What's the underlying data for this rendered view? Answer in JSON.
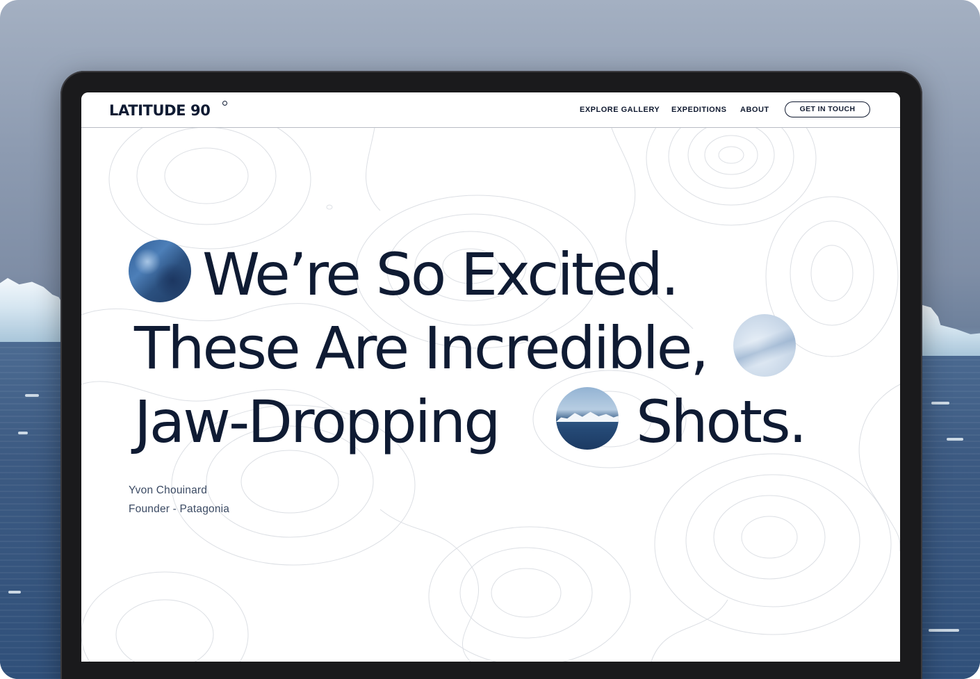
{
  "nav": {
    "logo": "LATITUDE 90",
    "links": [
      {
        "label": "EXPLORE GALLERY"
      },
      {
        "label": "EXPEDITIONS"
      },
      {
        "label": "ABOUT"
      }
    ],
    "cta": "GET IN TOUCH"
  },
  "hero": {
    "line1": "We’re So Excited.",
    "line2": "These Are Incredible,",
    "line3a": "Jaw-Dropping",
    "line3b": "Shots."
  },
  "attribution": {
    "name": "Yvon Chouinard",
    "role": "Founder - Patagonia"
  },
  "colors": {
    "ink": "#0f1b33",
    "muted": "#3b4a63",
    "background": "#ffffff"
  },
  "icons": {
    "degree": "degree-symbol",
    "photo_1": "glacier-photo",
    "photo_2": "ice-photo",
    "photo_3": "mountains-photo"
  }
}
